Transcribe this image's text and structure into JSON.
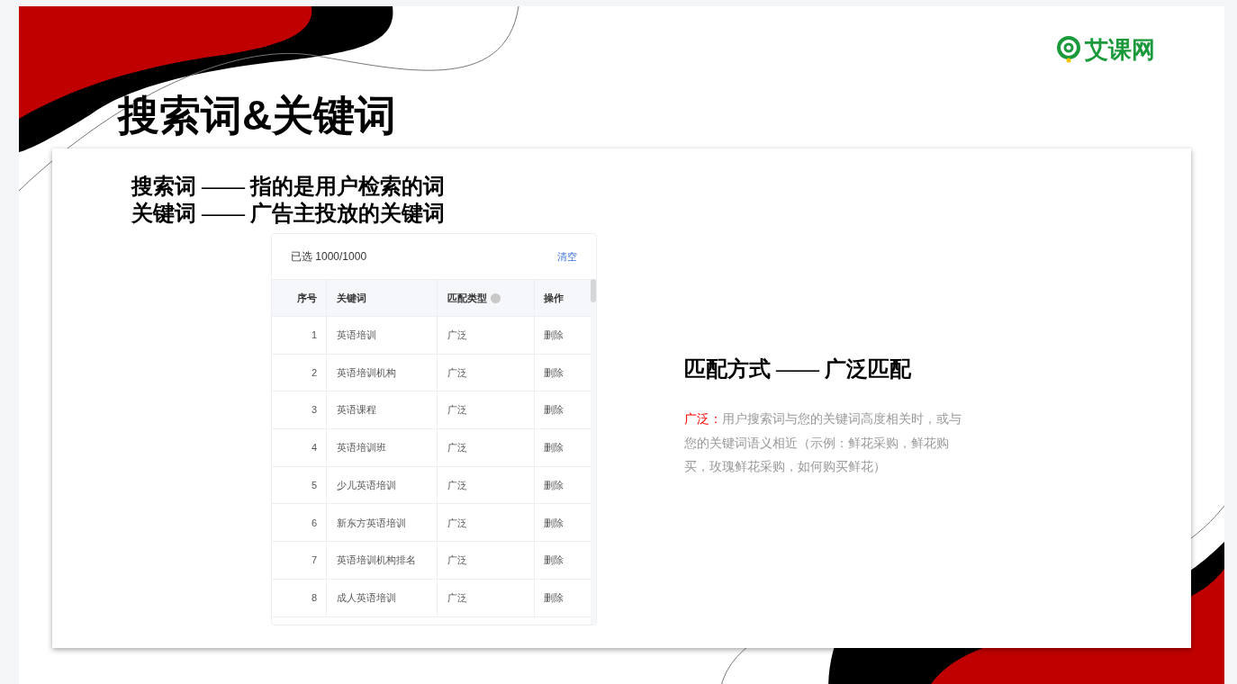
{
  "logo": {
    "text": "艾课网"
  },
  "title": "搜索词&关键词",
  "definitions": [
    "搜索词 —— 指的是用户检索的词",
    "关键词 —— 广告主投放的关键词"
  ],
  "table_card": {
    "selected_count": "已选 1000/1000",
    "clear_link": "清空",
    "columns": [
      "序号",
      "关键词",
      "匹配类型",
      "操作"
    ],
    "rows": [
      {
        "index": "1",
        "keyword": "英语培训",
        "match": "广泛",
        "action": "删除"
      },
      {
        "index": "2",
        "keyword": "英语培训机构",
        "match": "广泛",
        "action": "删除"
      },
      {
        "index": "3",
        "keyword": "英语课程",
        "match": "广泛",
        "action": "删除"
      },
      {
        "index": "4",
        "keyword": "英语培训班",
        "match": "广泛",
        "action": "删除"
      },
      {
        "index": "5",
        "keyword": "少儿英语培训",
        "match": "广泛",
        "action": "删除"
      },
      {
        "index": "6",
        "keyword": "新东方英语培训",
        "match": "广泛",
        "action": "删除"
      },
      {
        "index": "7",
        "keyword": "英语培训机构排名",
        "match": "广泛",
        "action": "删除"
      },
      {
        "index": "8",
        "keyword": "成人英语培训",
        "match": "广泛",
        "action": "删除"
      }
    ]
  },
  "match_section": {
    "heading": "匹配方式 —— 广泛匹配",
    "term": "广泛：",
    "description": "用户搜索词与您的关键词高度相关时，或与您的关键词语义相近（示例：鲜花采购，鲜花购买，玫瑰鲜花采购，如何购买鲜花）"
  }
}
